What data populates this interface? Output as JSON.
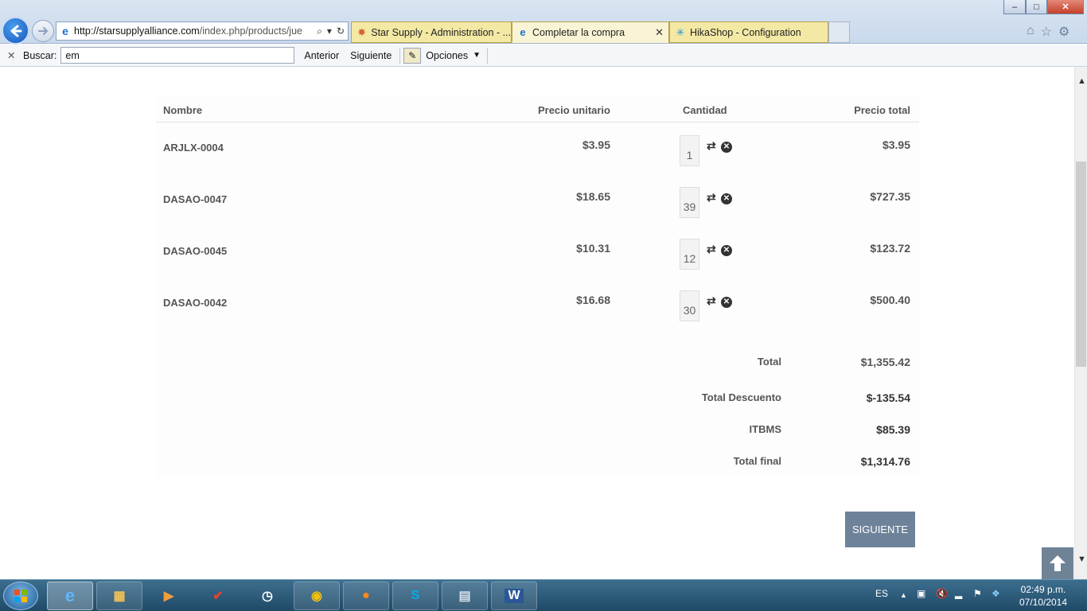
{
  "browser": {
    "url_host": "http://starsupplyalliance.com",
    "url_path": "/index.php/products/jue",
    "tabs": [
      {
        "label": "Star Supply - Administration - ..."
      },
      {
        "label": "Completar la compra"
      },
      {
        "label": "HikaShop - Configuration"
      }
    ],
    "window": {
      "minimize": "–",
      "maximize": "□",
      "close": "✕"
    }
  },
  "findbar": {
    "label": "Buscar:",
    "value": "em",
    "prev": "Anterior",
    "next": "Siguiente",
    "options": "Opciones"
  },
  "cart": {
    "headers": {
      "name": "Nombre",
      "unit_price": "Precio unitario",
      "quantity": "Cantidad",
      "total_price": "Precio total"
    },
    "items": [
      {
        "name": "ARJLX-0004",
        "unit": "$3.95",
        "qty": "1",
        "total": "$3.95"
      },
      {
        "name": "DASAO-0047",
        "unit": "$18.65",
        "qty": "39",
        "total": "$727.35"
      },
      {
        "name": "DASAO-0045",
        "unit": "$10.31",
        "qty": "12",
        "total": "$123.72"
      },
      {
        "name": "DASAO-0042",
        "unit": "$16.68",
        "qty": "30",
        "total": "$500.40"
      }
    ],
    "summary": {
      "total_label": "Total",
      "total_value": "$1,355.42",
      "discount_label": "Total Descuento",
      "discount_value": "$-135.54",
      "tax_label": "ITBMS",
      "tax_value": "$85.39",
      "final_label": "Total final",
      "final_value": "$1,314.76"
    },
    "next_button": "SIGUIENTE"
  },
  "taskbar": {
    "language": "ES",
    "time": "02:49 p.m.",
    "date": "07/10/2014"
  },
  "colors": {
    "button_bg": "#6e8399",
    "tab_active": "#f9f4d5",
    "tab_inactive": "#f3e9a4"
  }
}
